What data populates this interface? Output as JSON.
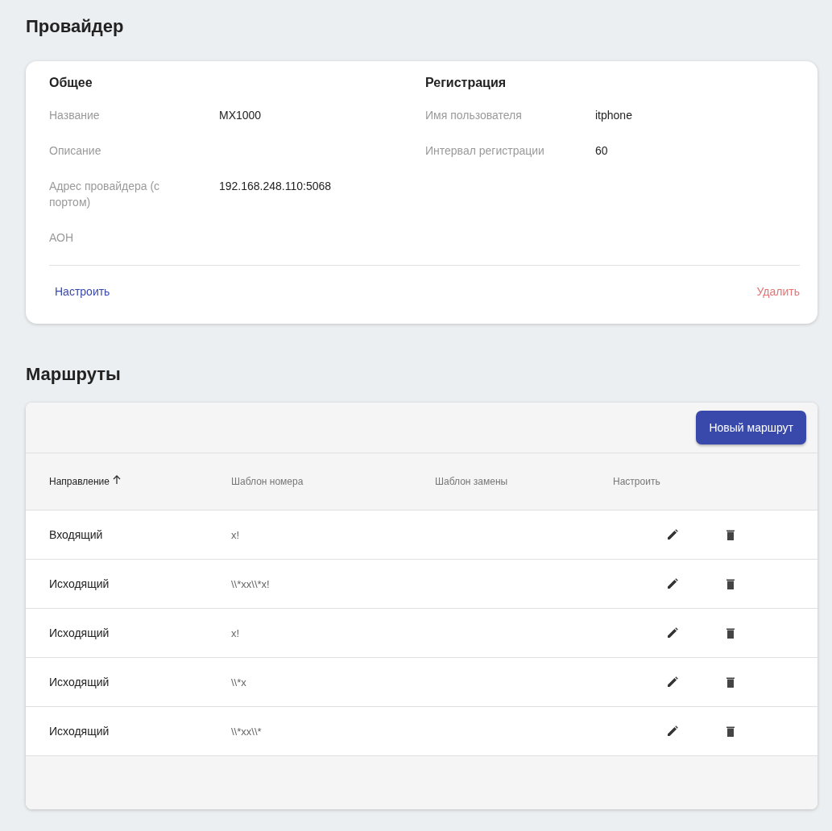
{
  "provider": {
    "title": "Провайдер",
    "general": {
      "title": "Общее",
      "fields": [
        {
          "label": "Название",
          "value": "MX1000"
        },
        {
          "label": "Описание"
        },
        {
          "label": "Адрес провайдера (с портом)",
          "value": "192.168.248.110:5068"
        },
        {
          "label": "АОН"
        }
      ]
    },
    "registration": {
      "title": "Регистрация",
      "fields": [
        {
          "label": "Имя пользователя",
          "value": "itphone"
        },
        {
          "label": "Интервал регистрации",
          "value": "60"
        }
      ]
    },
    "actions": [
      {
        "label": "Настроить",
        "kind": "primary"
      },
      {
        "label": "Удалить",
        "kind": "danger"
      }
    ]
  },
  "routes": {
    "title": "Маршруты",
    "new_button": "Новый маршрут",
    "columns": [
      {
        "label": "Направление",
        "sorted": true
      },
      {
        "label": "Шаблон номера",
        "sorted": false
      },
      {
        "label": "Шаблон замены",
        "sorted": false
      },
      {
        "label": "Настроить",
        "sorted": false
      }
    ],
    "rows": [
      {
        "direction": "Входящий",
        "pattern": "x!"
      },
      {
        "direction": "Исходящий",
        "pattern": "\\\\*xx\\\\*x!"
      },
      {
        "direction": "Исходящий",
        "pattern": "x!"
      },
      {
        "direction": "Исходящий",
        "pattern": "\\\\*x"
      },
      {
        "direction": "Исходящий",
        "pattern": "\\\\*xx\\\\*"
      }
    ]
  }
}
